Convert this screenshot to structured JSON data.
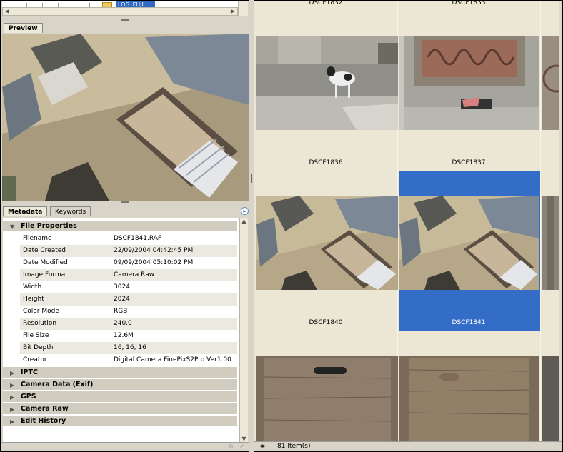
{
  "folder_tree": {
    "selected_folder": "LOG_FUJI"
  },
  "preview": {
    "tab_label": "Preview"
  },
  "metadata_panel": {
    "tabs": [
      "Metadata",
      "Keywords"
    ],
    "file_properties_label": "File Properties",
    "rows": [
      {
        "key": "Filename",
        "value": "DSCF1841.RAF"
      },
      {
        "key": "Date Created",
        "value": "22/09/2004 04:42:45 PM"
      },
      {
        "key": "Date Modified",
        "value": "09/09/2004 05:10:02 PM"
      },
      {
        "key": "Image Format",
        "value": "Camera Raw"
      },
      {
        "key": "Width",
        "value": "3024"
      },
      {
        "key": "Height",
        "value": "2024"
      },
      {
        "key": "Color Mode",
        "value": "RGB"
      },
      {
        "key": "Resolution",
        "value": "240.0"
      },
      {
        "key": "File Size",
        "value": "12.6M"
      },
      {
        "key": "Bit Depth",
        "value": "16, 16, 16"
      },
      {
        "key": "Creator",
        "value": "Digital Camera FinePixS2Pro Ver1.00"
      }
    ],
    "collapsed_sections": [
      "IPTC",
      "Camera Data (Exif)",
      "GPS",
      "Camera Raw",
      "Edit History"
    ],
    "colon": ":"
  },
  "thumbnails": {
    "top_captions": [
      "DSCF1832",
      "DSCF1833"
    ],
    "row1_captions": [
      "DSCF1836",
      "DSCF1837"
    ],
    "row2_captions": [
      "DSCF1840",
      "DSCF1841"
    ],
    "selected": "DSCF1841"
  },
  "status": {
    "item_count": "81 Item(s)"
  },
  "colors": {
    "selection": "#346dc7",
    "panel_bg": "#d8d4c8",
    "grid_bg": "#ece6d4"
  }
}
